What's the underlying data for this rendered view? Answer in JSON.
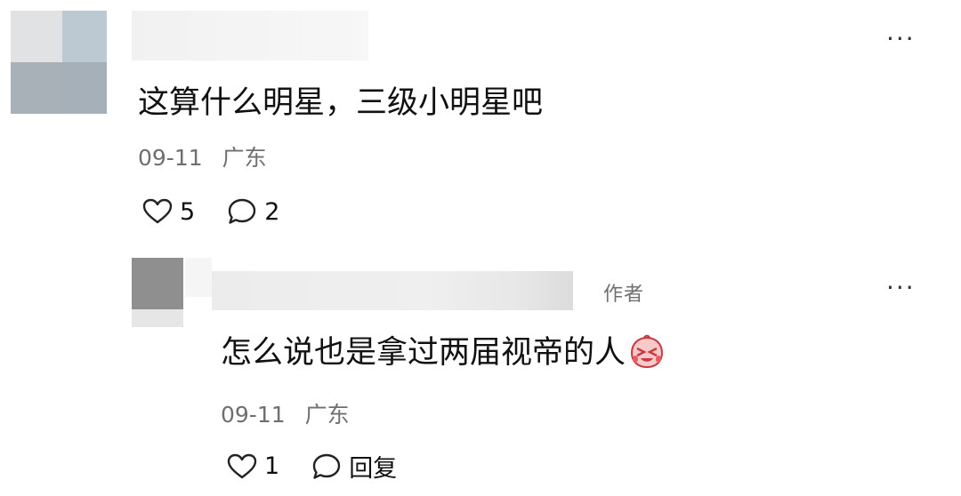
{
  "comment": {
    "text": "这算什么明星，三级小明星吧",
    "date": "09-11",
    "location": "广东",
    "likes": "5",
    "replies": "2",
    "more_label": "···"
  },
  "reply": {
    "author_tag": "作者",
    "text": "怎么说也是拿过两届视帝的人",
    "emoji": "laughing-tears-emoji",
    "date": "09-11",
    "location": "广东",
    "likes": "1",
    "reply_label": "回复",
    "more_label": "···"
  },
  "colors": {
    "text_primary": "#111111",
    "text_secondary": "#6f6f6f"
  }
}
